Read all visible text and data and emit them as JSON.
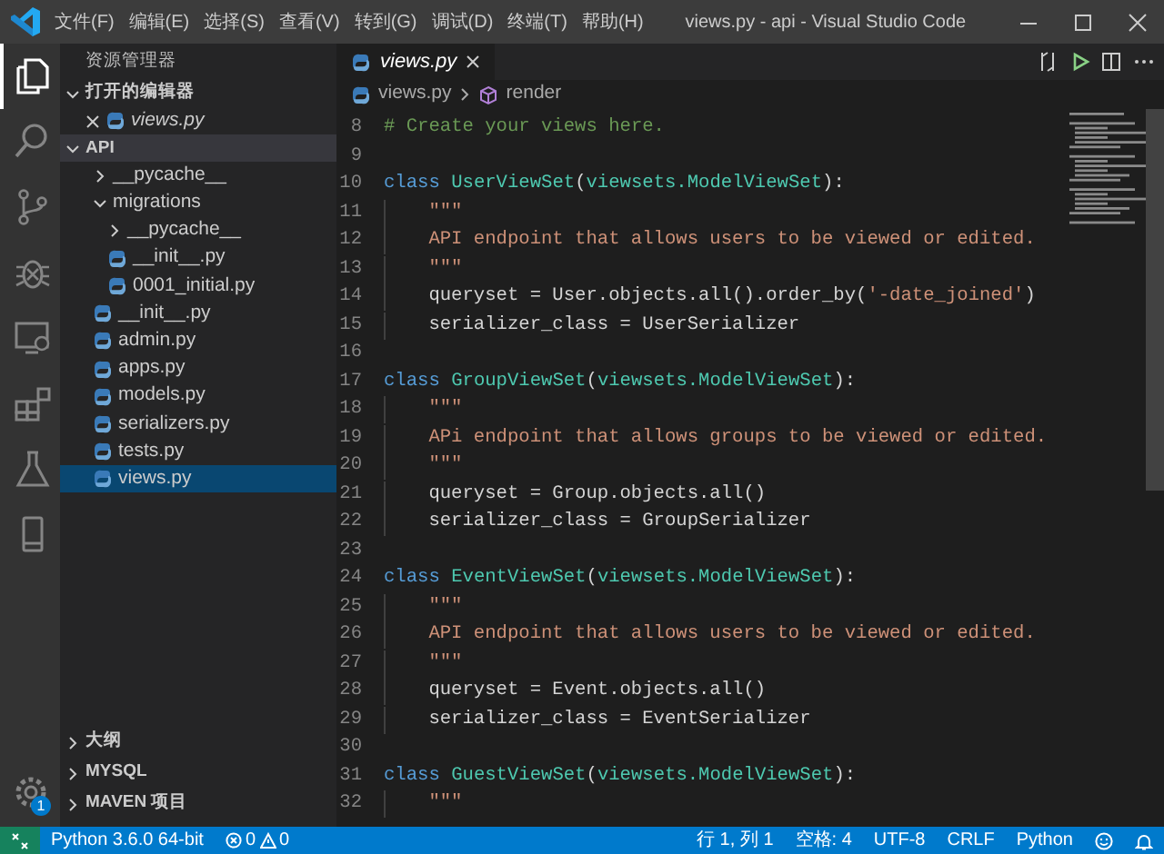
{
  "window": {
    "title": "views.py - api - Visual Studio Code"
  },
  "menu": [
    {
      "label": "文件(F)"
    },
    {
      "label": "编辑(E)"
    },
    {
      "label": "选择(S)"
    },
    {
      "label": "查看(V)"
    },
    {
      "label": "转到(G)"
    },
    {
      "label": "调试(D)"
    },
    {
      "label": "终端(T)"
    },
    {
      "label": "帮助(H)"
    }
  ],
  "activity_bar": [
    {
      "kind": "explorer",
      "selected": true
    },
    {
      "kind": "search",
      "selected": false
    },
    {
      "kind": "source-control",
      "selected": false
    },
    {
      "kind": "debug",
      "selected": false
    },
    {
      "kind": "remote",
      "selected": false
    },
    {
      "kind": "extensions",
      "selected": false
    },
    {
      "kind": "test",
      "selected": false
    },
    {
      "kind": "device",
      "selected": false
    }
  ],
  "settings_badge": "1",
  "sidebar": {
    "title": "资源管理器",
    "open_editors": {
      "label": "打开的编辑器",
      "expanded": true,
      "items": [
        {
          "name": "views.py"
        }
      ]
    },
    "folder": {
      "label": "API",
      "expanded": true,
      "children": [
        {
          "name": "__pycache__",
          "kind": "folder",
          "expanded": false,
          "selected": false
        },
        {
          "name": "migrations",
          "kind": "folder",
          "expanded": true,
          "selected": false,
          "children": [
            {
              "name": "__pycache__",
              "kind": "folder",
              "expanded": false,
              "selected": false
            },
            {
              "name": "__init__.py",
              "kind": "file",
              "selected": false
            },
            {
              "name": "0001_initial.py",
              "kind": "file",
              "selected": false
            }
          ]
        },
        {
          "name": "__init__.py",
          "kind": "file",
          "selected": false
        },
        {
          "name": "admin.py",
          "kind": "file",
          "selected": false
        },
        {
          "name": "apps.py",
          "kind": "file",
          "selected": false
        },
        {
          "name": "models.py",
          "kind": "file",
          "selected": false
        },
        {
          "name": "serializers.py",
          "kind": "file",
          "selected": false
        },
        {
          "name": "tests.py",
          "kind": "file",
          "selected": false
        },
        {
          "name": "views.py",
          "kind": "file",
          "selected": true
        }
      ]
    },
    "sections": [
      {
        "label": "大纲",
        "expanded": false
      },
      {
        "label": "MYSQL",
        "expanded": false
      },
      {
        "label": "MAVEN 项目",
        "expanded": false
      }
    ]
  },
  "tabs": [
    {
      "label": "views.py",
      "selected": true,
      "preview": true
    }
  ],
  "breadcrumb": [
    {
      "label": "views.py",
      "kind": "file"
    },
    {
      "label": "render",
      "kind": "symbol"
    }
  ],
  "code": [
    {
      "number": "8",
      "tokens": [
        {
          "kind": "comment",
          "text": "# Create your views here."
        }
      ]
    },
    {
      "number": "9"
    },
    {
      "number": "10",
      "tokens": [
        {
          "kind": "keyword",
          "text": "class"
        },
        {
          "kind": "class",
          "text": " UserViewSet"
        },
        {
          "kind": "plain",
          "text": "("
        },
        {
          "kind": "class",
          "text": "viewsets.ModelViewSet"
        },
        {
          "kind": "plain",
          "text": "):"
        }
      ]
    },
    {
      "number": "11",
      "indented": true,
      "tokens": [
        {
          "kind": "string",
          "text": "\"\"\""
        }
      ]
    },
    {
      "number": "12",
      "indented": true,
      "tokens": [
        {
          "kind": "string",
          "text": "API endpoint that allows users to be viewed or edited."
        }
      ]
    },
    {
      "number": "13",
      "indented": true,
      "tokens": [
        {
          "kind": "string",
          "text": "\"\"\""
        }
      ]
    },
    {
      "number": "14",
      "indented": true,
      "tokens": [
        {
          "kind": "plain",
          "text": "queryset = User.objects.all().order_by("
        },
        {
          "kind": "string",
          "text": "'-date_joined'"
        },
        {
          "kind": "plain",
          "text": ")"
        }
      ]
    },
    {
      "number": "15",
      "indented": true,
      "tokens": [
        {
          "kind": "plain",
          "text": "serializer_class = UserSerializer"
        }
      ]
    },
    {
      "number": "16"
    },
    {
      "number": "17",
      "tokens": [
        {
          "kind": "keyword",
          "text": "class"
        },
        {
          "kind": "class",
          "text": " GroupViewSet"
        },
        {
          "kind": "plain",
          "text": "("
        },
        {
          "kind": "class",
          "text": "viewsets.ModelViewSet"
        },
        {
          "kind": "plain",
          "text": "):"
        }
      ]
    },
    {
      "number": "18",
      "indented": true,
      "tokens": [
        {
          "kind": "string",
          "text": "\"\"\""
        }
      ]
    },
    {
      "number": "19",
      "indented": true,
      "tokens": [
        {
          "kind": "string",
          "text": "APi endpoint that allows groups to be viewed or edited."
        }
      ]
    },
    {
      "number": "20",
      "indented": true,
      "tokens": [
        {
          "kind": "string",
          "text": "\"\"\""
        }
      ]
    },
    {
      "number": "21",
      "indented": true,
      "tokens": [
        {
          "kind": "plain",
          "text": "queryset = Group.objects.all()"
        }
      ]
    },
    {
      "number": "22",
      "indented": true,
      "tokens": [
        {
          "kind": "plain",
          "text": "serializer_class = GroupSerializer"
        }
      ]
    },
    {
      "number": "23"
    },
    {
      "number": "24",
      "tokens": [
        {
          "kind": "keyword",
          "text": "class"
        },
        {
          "kind": "class",
          "text": " EventViewSet"
        },
        {
          "kind": "plain",
          "text": "("
        },
        {
          "kind": "class",
          "text": "viewsets.ModelViewSet"
        },
        {
          "kind": "plain",
          "text": "):"
        }
      ]
    },
    {
      "number": "25",
      "indented": true,
      "tokens": [
        {
          "kind": "string",
          "text": "\"\"\""
        }
      ]
    },
    {
      "number": "26",
      "indented": true,
      "tokens": [
        {
          "kind": "string",
          "text": "API endpoint that allows users to be viewed or edited."
        }
      ]
    },
    {
      "number": "27",
      "indented": true,
      "tokens": [
        {
          "kind": "string",
          "text": "\"\"\""
        }
      ]
    },
    {
      "number": "28",
      "indented": true,
      "tokens": [
        {
          "kind": "plain",
          "text": "queryset = Event.objects.all()"
        }
      ]
    },
    {
      "number": "29",
      "indented": true,
      "tokens": [
        {
          "kind": "plain",
          "text": "serializer_class = EventSerializer"
        }
      ]
    },
    {
      "number": "30"
    },
    {
      "number": "31",
      "tokens": [
        {
          "kind": "keyword",
          "text": "class"
        },
        {
          "kind": "class",
          "text": " GuestViewSet"
        },
        {
          "kind": "plain",
          "text": "("
        },
        {
          "kind": "class",
          "text": "viewsets.ModelViewSet"
        },
        {
          "kind": "plain",
          "text": "):"
        }
      ]
    },
    {
      "number": "32",
      "indented": true,
      "tokens": [
        {
          "kind": "string",
          "text": "\"\"\""
        }
      ]
    }
  ],
  "status_bar": {
    "interpreter": "Python 3.6.0 64-bit",
    "errors": "0",
    "warnings": "0",
    "right": [
      {
        "label": "行 1, 列 1"
      },
      {
        "label": "空格: 4"
      },
      {
        "label": "UTF-8"
      },
      {
        "label": "CRLF"
      },
      {
        "label": "Python"
      }
    ]
  }
}
